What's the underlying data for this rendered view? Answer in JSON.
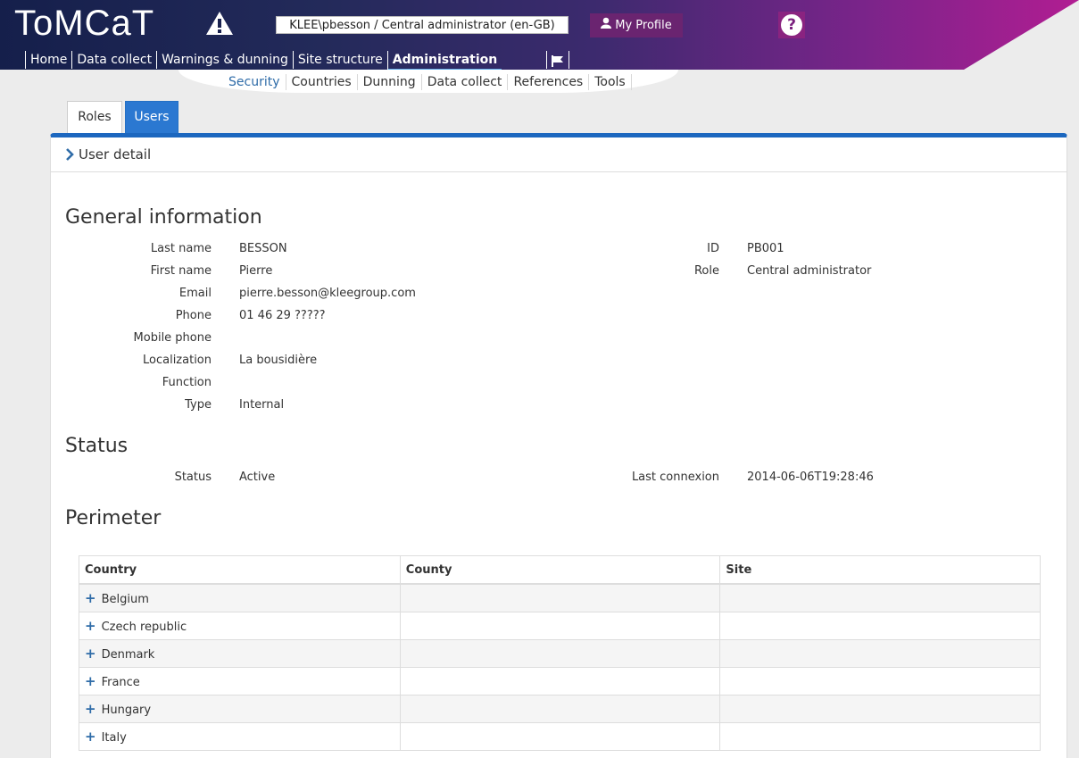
{
  "header": {
    "logo": "ToMCaT",
    "user_context": "KLEE\\pbesson / Central administrator (en-GB)",
    "profile_label": "My Profile"
  },
  "main_nav": [
    "Home",
    "Data collect",
    "Warnings & dunning",
    "Site structure",
    "Administration"
  ],
  "main_nav_active": "Administration",
  "sub_nav": [
    "Security",
    "Countries",
    "Dunning",
    "Data collect",
    "References",
    "Tools"
  ],
  "sub_nav_active": "Security",
  "tabs": [
    "Roles",
    "Users"
  ],
  "tabs_active": "Users",
  "panel_title": "User detail",
  "general": {
    "title": "General information",
    "fields": [
      {
        "label": "Last name",
        "value": "BESSON"
      },
      {
        "label": "First name",
        "value": "Pierre"
      },
      {
        "label": "Email",
        "value": "pierre.besson@kleegroup.com"
      },
      {
        "label": "Phone",
        "value": "01 46 29 ?????"
      },
      {
        "label": "Mobile phone",
        "value": ""
      },
      {
        "label": "Localization",
        "value": "La bousidière"
      },
      {
        "label": "Function",
        "value": ""
      },
      {
        "label": "Type",
        "value": "Internal"
      }
    ],
    "right_fields": [
      {
        "label": "ID",
        "value": "PB001"
      },
      {
        "label": "Role",
        "value": "Central administrator"
      }
    ]
  },
  "status": {
    "title": "Status",
    "status_label": "Status",
    "status_value": "Active",
    "last_label": "Last connexion",
    "last_value": "2014-06-06T19:28:46"
  },
  "perimeter": {
    "title": "Perimeter",
    "columns": [
      "Country",
      "County",
      "Site"
    ],
    "rows": [
      "Belgium",
      "Czech republic",
      "Denmark",
      "France",
      "Hungary",
      "Italy"
    ]
  },
  "colors": {
    "accent": "#1c67bf",
    "tab_active": "#2b78d1",
    "profile_button": "#6a2470",
    "link": "#2f6ca8"
  },
  "icons": [
    "warning-icon",
    "user-icon",
    "help-icon",
    "flag-icon",
    "chevron-right-icon",
    "plus-icon"
  ]
}
